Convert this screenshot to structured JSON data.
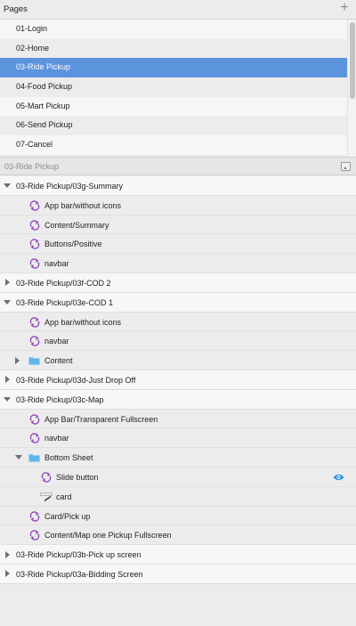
{
  "pages_panel": {
    "title": "Pages",
    "add_icon": "plus-icon",
    "pages": [
      {
        "label": "01-Login",
        "selected": false
      },
      {
        "label": "02-Home",
        "selected": false
      },
      {
        "label": "03-Ride Pickup",
        "selected": true
      },
      {
        "label": "04-Food Pickup",
        "selected": false
      },
      {
        "label": "05-Mart Pickup",
        "selected": false
      },
      {
        "label": "06-Send Pickup",
        "selected": false
      },
      {
        "label": "07-Cancel",
        "selected": false
      }
    ]
  },
  "layers_panel": {
    "title": "03-Ride Pickup",
    "collapse_icon": "collapse-all-icon",
    "rows": [
      {
        "label": "03-Ride Pickup/03g-Summary",
        "level": 0,
        "kind": "artboard",
        "expanded": true
      },
      {
        "label": "App bar/without icons",
        "level": 1,
        "kind": "symbol"
      },
      {
        "label": "Content/Summary",
        "level": 1,
        "kind": "symbol"
      },
      {
        "label": "Buttons/Positive",
        "level": 1,
        "kind": "symbol"
      },
      {
        "label": "navbar",
        "level": 1,
        "kind": "symbol"
      },
      {
        "label": "03-Ride Pickup/03f-COD 2",
        "level": 0,
        "kind": "artboard",
        "expanded": false
      },
      {
        "label": "03-Ride Pickup/03e-COD 1",
        "level": 0,
        "kind": "artboard",
        "expanded": true
      },
      {
        "label": "App bar/without icons",
        "level": 1,
        "kind": "symbol"
      },
      {
        "label": "navbar",
        "level": 1,
        "kind": "symbol"
      },
      {
        "label": "Content",
        "level": 1,
        "kind": "folder",
        "expanded": false
      },
      {
        "label": "03-Ride Pickup/03d-Just Drop Off",
        "level": 0,
        "kind": "artboard",
        "expanded": false
      },
      {
        "label": "03-Ride Pickup/03c-Map",
        "level": 0,
        "kind": "artboard",
        "expanded": true
      },
      {
        "label": "App Bar/Transparent Fullscreen",
        "level": 1,
        "kind": "symbol"
      },
      {
        "label": "navbar",
        "level": 1,
        "kind": "symbol"
      },
      {
        "label": "Bottom Sheet",
        "level": 1,
        "kind": "folder",
        "expanded": true
      },
      {
        "label": "Slide button",
        "level": 2,
        "kind": "symbol",
        "visibility_icon": "eye-icon"
      },
      {
        "label": "card",
        "level": 2,
        "kind": "shape"
      },
      {
        "label": "Card/Pick up",
        "level": 1,
        "kind": "symbol"
      },
      {
        "label": "Content/Map one Pickup Fullscreen",
        "level": 1,
        "kind": "symbol"
      },
      {
        "label": "03-Ride Pickup/03b-Pick up screen",
        "level": 0,
        "kind": "artboard",
        "expanded": false
      },
      {
        "label": "03-Ride Pickup/03a-Bidding Screen",
        "level": 0,
        "kind": "artboard",
        "expanded": false
      }
    ]
  },
  "colors": {
    "selection": "#5b93dd",
    "symbol_icon": "#8e3fc0",
    "folder_icon": "#5fb6ec",
    "eye_icon": "#2b8fdb"
  }
}
